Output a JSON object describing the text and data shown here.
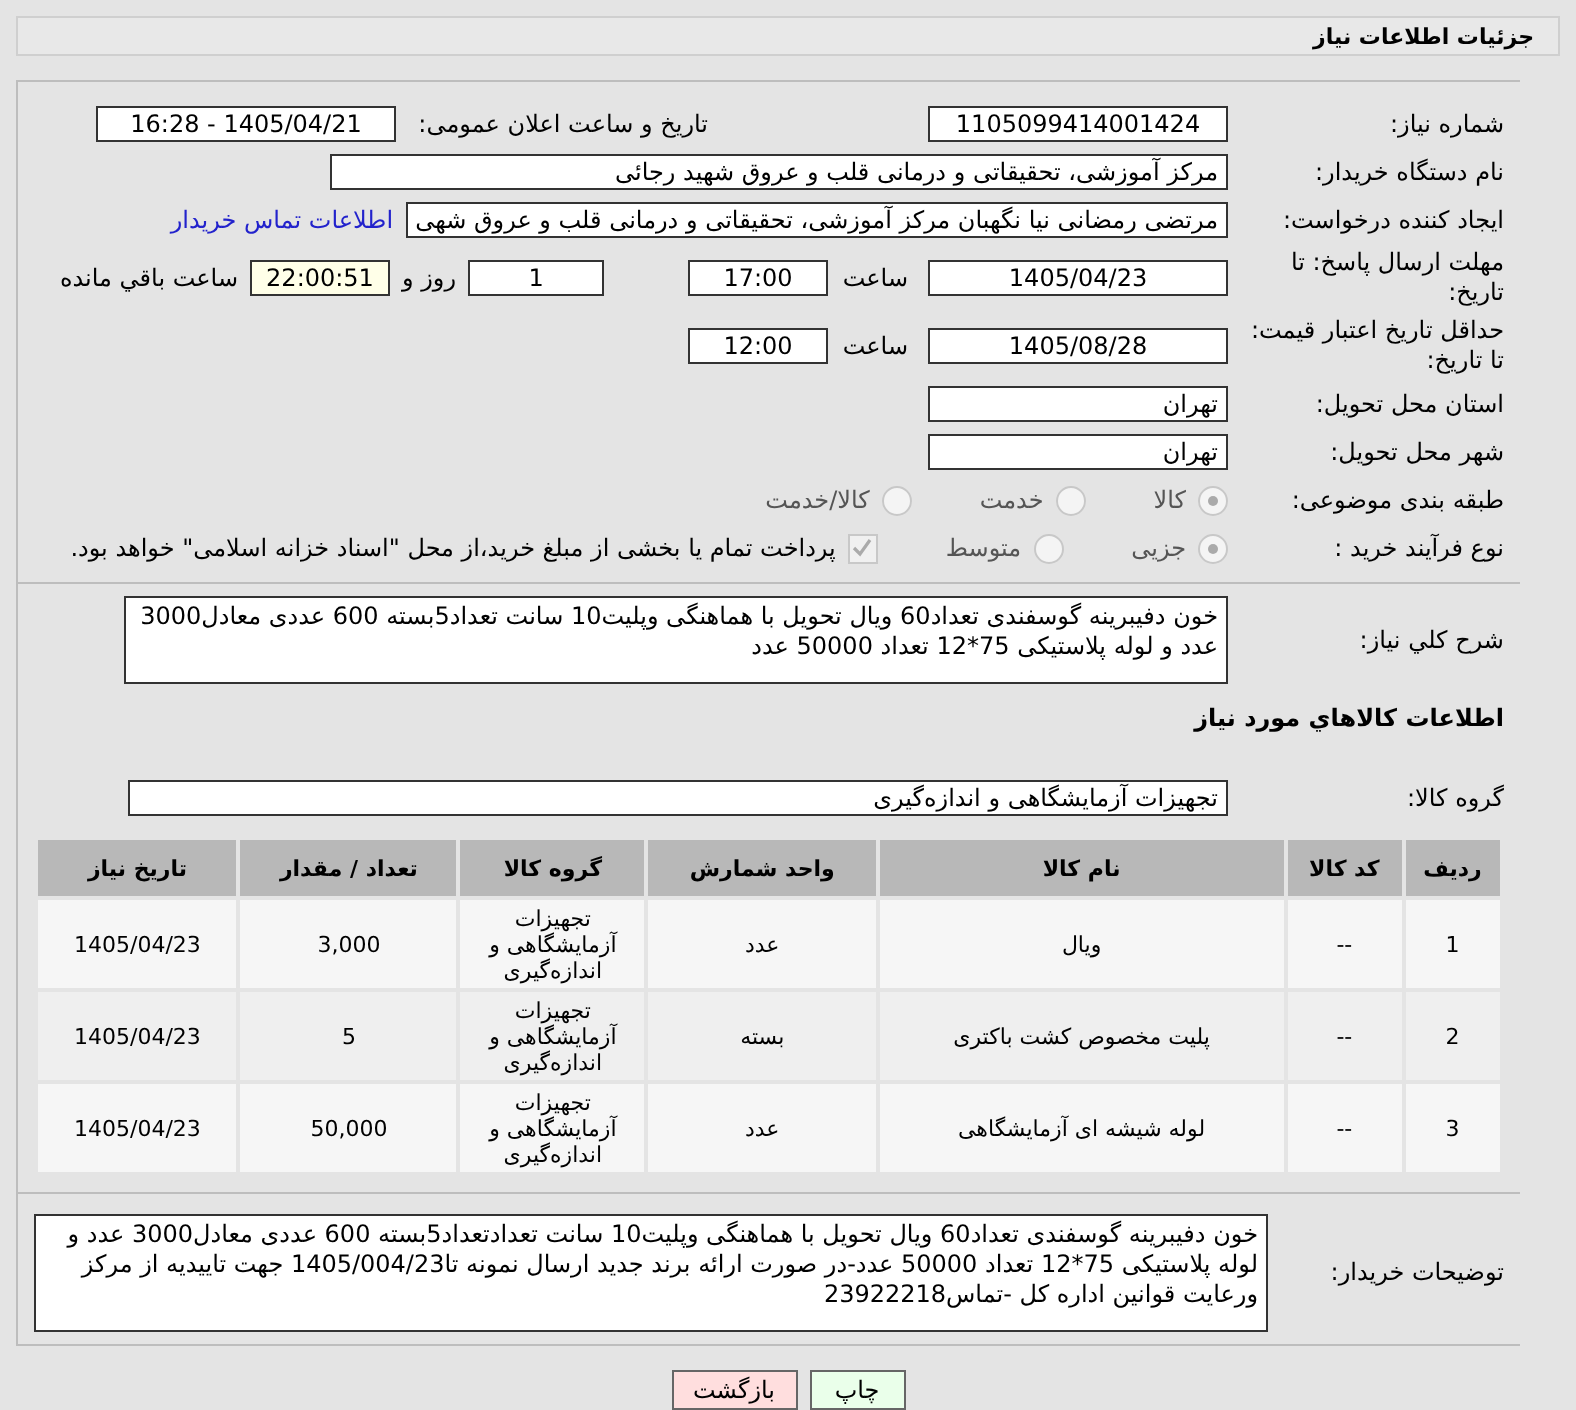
{
  "header": {
    "title": "جزئیات اطلاعات نیاز"
  },
  "need_number": {
    "label": "شماره نیاز:",
    "value": "1105099414001424"
  },
  "announce": {
    "label": "تاریخ و ساعت اعلان عمومی:",
    "value": "1405/04/21 - 16:28"
  },
  "buyer": {
    "label": "نام دستگاه خریدار:",
    "value": "مرکز آموزشی، تحقیقاتی و درمانی قلب و عروق شهید رجائی"
  },
  "creator": {
    "label": "ایجاد کننده درخواست:",
    "value": "مرتضی رمضانی نیا نگهبان مرکز آموزشی، تحقیقاتی و درمانی قلب و عروق شهی",
    "link": "اطلاعات تماس خریدار"
  },
  "deadline": {
    "label": "مهلت ارسال پاسخ: تا تاریخ:",
    "date": "1405/04/23",
    "time_label": "ساعت",
    "time": "17:00",
    "days": "1",
    "days_label": "روز و",
    "remaining": "22:00:51",
    "remaining_label": "ساعت باقي مانده"
  },
  "validity": {
    "label": "حداقل تاریخ اعتبار قیمت: تا تاریخ:",
    "date": "1405/08/28",
    "time_label": "ساعت",
    "time": "12:00"
  },
  "province": {
    "label": "استان محل تحویل:",
    "value": "تهران"
  },
  "city": {
    "label": "شهر محل تحویل:",
    "value": "تهران"
  },
  "category": {
    "label": "طبقه بندی موضوعی:",
    "options": [
      {
        "label": "کالا",
        "selected": true
      },
      {
        "label": "خدمت",
        "selected": false
      },
      {
        "label": "کالا/خدمت",
        "selected": false
      }
    ]
  },
  "process": {
    "label": "نوع فرآیند خرید :",
    "options": [
      {
        "label": "جزیی",
        "selected": true
      },
      {
        "label": "متوسط",
        "selected": false
      }
    ],
    "treasury": {
      "label": "پرداخت تمام یا بخشی از مبلغ خرید،از محل \"اسناد خزانه اسلامی\" خواهد بود.",
      "checked": true
    }
  },
  "description": {
    "label": "شرح کلي نیاز:",
    "value": "خون دفیبرینه گوسفندی تعداد60 ویال تحویل با هماهنگی وپلیت10 سانت تعداد5بسته 600 عددی معادل3000 عدد و لوله پلاستیکی 75*12 تعداد 50000 عدد"
  },
  "goods_heading": "اطلاعات کالاهاي مورد نياز",
  "goods_group": {
    "label": "گروه کالا:",
    "value": "تجهیزات آزمایشگاهی و اندازه‌گیری"
  },
  "table": {
    "columns": [
      "ردیف",
      "کد کالا",
      "نام کالا",
      "واحد شمارش",
      "گروه کالا",
      "تعداد / مقدار",
      "تاریخ نیاز"
    ],
    "rows": [
      [
        "1",
        "--",
        "ویال",
        "عدد",
        "تجهیزات آزمایشگاهی و اندازه‌گیری",
        "3,000",
        "1405/04/23"
      ],
      [
        "2",
        "--",
        "پلیت مخصوص کشت باکتری",
        "بسته",
        "تجهیزات آزمایشگاهی و اندازه‌گیری",
        "5",
        "1405/04/23"
      ],
      [
        "3",
        "--",
        "لوله شیشه ای آزمایشگاهی",
        "عدد",
        "تجهیزات آزمایشگاهی و اندازه‌گیری",
        "50,000",
        "1405/04/23"
      ]
    ]
  },
  "buyer_notes": {
    "label": "توضیحات خریدار:",
    "value": "خون دفیبرینه گوسفندی تعداد60 ویال تحویل با هماهنگی وپلیت10 سانت تعدادتعداد5بسته 600 عددی معادل3000 عدد و لوله پلاستیکی 75*12 تعداد 50000 عدد-در صورت ارائه برند جدید ارسال نمونه تا1405/004/23 جهت تاییدیه از مرکز ورعایت قوانین اداره کل -تماس23922218"
  },
  "buttons": [
    {
      "label": "چاپ",
      "kind": "print"
    },
    {
      "label": "بازگشت",
      "kind": "back"
    }
  ]
}
